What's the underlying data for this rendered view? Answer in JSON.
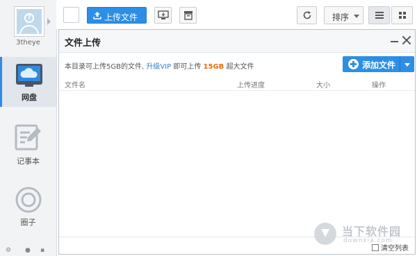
{
  "sidebar": {
    "username": "3theye",
    "items": [
      {
        "label": "网盘",
        "icon": "cloud-drive-icon"
      },
      {
        "label": "记事本",
        "icon": "notepad-icon"
      },
      {
        "label": "圈子",
        "icon": "circle-icon"
      }
    ]
  },
  "toolbar": {
    "upload_label": "上传文件",
    "sort_label": "排序"
  },
  "panel": {
    "title": "文件上传",
    "info_prefix": "本目录可上传5GB的文件,",
    "info_link": "升级VIP",
    "info_middle": " 即可上传",
    "info_highlight": "15GB",
    "info_suffix": "超大文件",
    "add_label": "添加文件",
    "columns": [
      "文件名",
      "上传进度",
      "大小",
      "操作"
    ],
    "clear_label": "清空列表"
  },
  "watermark": {
    "title": "当下软件园",
    "url": "downxia.com"
  },
  "colors": {
    "accent": "#2d8ee6",
    "highlight": "#f06a0c",
    "link": "#2f7fd1"
  }
}
